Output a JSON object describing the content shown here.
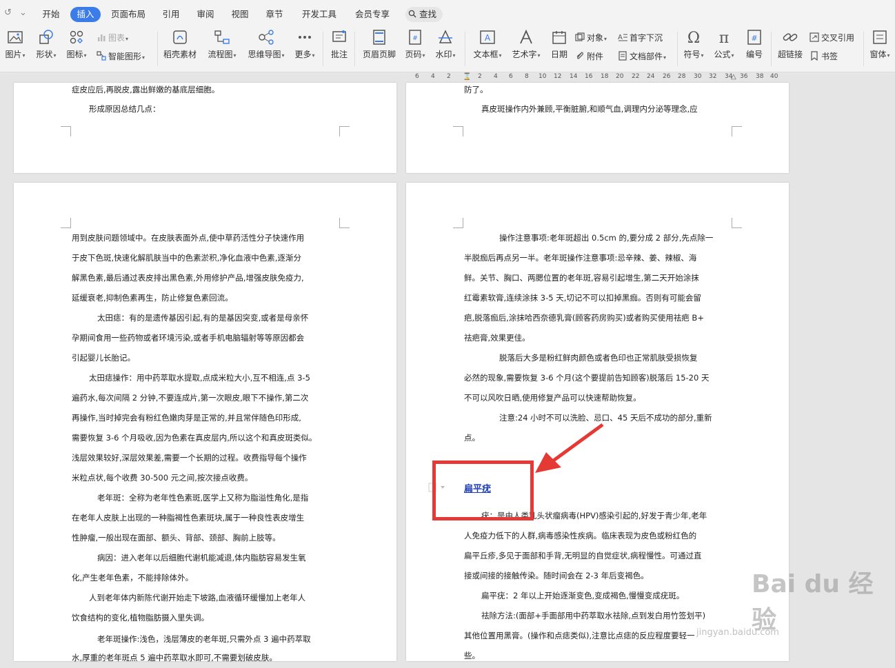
{
  "menubar": {
    "undo_glyph": "↺",
    "more_glyph": "⌄",
    "tabs": [
      "开始",
      "插入",
      "页面布局",
      "引用",
      "审阅",
      "视图",
      "章节",
      "开发工具",
      "会员专享"
    ],
    "active_tab": "插入",
    "search_label": "查找"
  },
  "ribbon": {
    "picture": "图片",
    "shape": "形状",
    "icons": "图标",
    "chart": "图表",
    "smart_graphic": "智能图形",
    "stock_material": "稻壳素材",
    "flowchart": "流程图",
    "mindmap": "思维导图",
    "more": "更多",
    "comment": "批注",
    "header_footer": "页眉页脚",
    "page_number": "页码",
    "watermark": "水印",
    "textbox": "文本框",
    "wordart": "艺术字",
    "date": "日期",
    "object": "对象",
    "attachment": "附件",
    "drop_cap": "首字下沉",
    "doc_parts": "文档部件",
    "symbol": "符号",
    "formula": "公式",
    "numbering": "编号",
    "hyperlink": "超链接",
    "cross_reference": "交叉引用",
    "bookmark": "书签",
    "window": "窗体"
  },
  "ruler": {
    "ticks": [
      "6",
      "4",
      "2",
      "2",
      "4",
      "6",
      "8",
      "10",
      "12",
      "14",
      "16",
      "18",
      "20",
      "22",
      "24",
      "26",
      "28",
      "30",
      "32",
      "34",
      "36",
      "38",
      "40"
    ]
  },
  "pages": {
    "top_left": {
      "lines": [
        "症皮应后,再脱皮,露出鲜嫩的基底层细胞。",
        "形成原因总结几点："
      ]
    },
    "top_right": {
      "lines": [
        "防了。",
        "真皮斑操作内外兼顾,平衡脏腑,和顺气血,调理内分泌等理念,应"
      ]
    },
    "left": {
      "lines": [
        "用到皮肤问题领域中。在皮肤表面外点,使中草药活性分子快速作用",
        "于皮下色斑,快速化解肌肤当中的色素淤积,净化血液中色素,逐渐分",
        "解黑色素,最后通过表皮排出黑色素,外用修护产品,增强皮肤免疫力,",
        "延缓衰老,抑制色素再生，防止修复色素回流。",
        "太田痣：有的是遗传基因引起,有的是基因突变,或者是母亲怀",
        "孕期间食用一些药物或者环境污染,或者手机电脑辐射等等原因都会",
        "引起婴儿长胎记。",
        "太田痣操作：用中药萃取水提取,点成米粒大小,互不相连,点 3-5",
        "遍药水,每次间隔 2 分钟,不要连成片,第一次眼皮,眼下不操作,第二次",
        "再操作,当时掉完会有粉红色嫩肉芽是正常的,并且常伴随色印形成,",
        "需要恢复 3-6 个月吸收,因为色素在真皮层内,所以这个和真皮斑类似。",
        "浅层效果较好,深层效果差,需要一个长期的过程。收费指导每个操作",
        "米粒点状,每个收费 30-500 元之间,按次接点收费。",
        "老年斑：全称为老年性色素斑,医学上又称为脂溢性角化,是指",
        "在老年人皮肤上出现的一种脂褐性色素斑块,属于一种良性表皮增生",
        "性肿瘤,一般出现在面部、额头、背部、颈部、胸前上肢等。",
        "病因：进入老年以后细胞代谢机能减退,体内脂肪容易发生氧",
        "化,产生老年色素，不能排除体外。",
        "人到老年体内新陈代谢开始走下坡路,血液循环缓慢加上老年人",
        "饮食结构的变化,植物脂肪摄入里失调。",
        "老年斑操作:浅色，浅层薄皮的老年斑,只需外点 3 遍中药萃取",
        "水,厚重的老年斑点 5 遍中药萃取水即可,不需要划破皮肤。"
      ]
    },
    "right": {
      "lines_a": [
        "操作注意事项:老年斑超出 0.5cm 的,要分成 2 部分,先点除一",
        "半脱痂后再点另一半。老年斑操作注意事项:忌辛辣、姜、辣椒、海",
        "鲜。关节、胸口、两腮位置的老年斑,容易引起增生,第二天开始涂抹",
        "红霉素软膏,连续涂抹 3-5 天,切记不可以扣掉黑痂。否则有可能会留",
        "疤,脱落痂后,涂抹哈西奈德乳膏(顾客药房购买)或者购买使用祛疤 B+",
        "祛疤膏,效果更佳。",
        "脱落后大多是粉红鲜肉颜色或者色印也正常肌肤受损恢复",
        "必然的现象,需要恢复 3-6 个月(这个要提前告知顾客)脱落后 15-20 天",
        "不可以风吹日晒,使用修复产品可以快速帮助恢复。",
        "注意:24 小时不可以洗脸、忌口、45 天后不成功的部分,重新",
        "点。"
      ],
      "heading": "扁平疣",
      "lines_b": [
        "疣：是由人类乳头状瘤病毒(HPV)感染引起的,好发于青少年,老年",
        "人免疫力低下的人群,病毒感染性疾病。临床表现为皮色或粉红色的",
        "扁平丘疹,多见于面部和手背,无明显的自觉症状,病程慢性。可通过直",
        "接或间接的接触传染。随时间会在 2-3 年后变褐色。",
        "扁平疣：2 年以上开始逐渐变色,变成褐色,慢慢变成疣斑。",
        "祛除方法:(面部+手面部用中药萃取水祛除,点到发白用竹签划平)",
        "其他位置用黑膏。(操作和点痣类似),注意比点痣的反应程度要轻一",
        "些。"
      ]
    }
  },
  "watermark": {
    "text": "Bai du 经验",
    "url": "jingyan.baidu.com"
  }
}
